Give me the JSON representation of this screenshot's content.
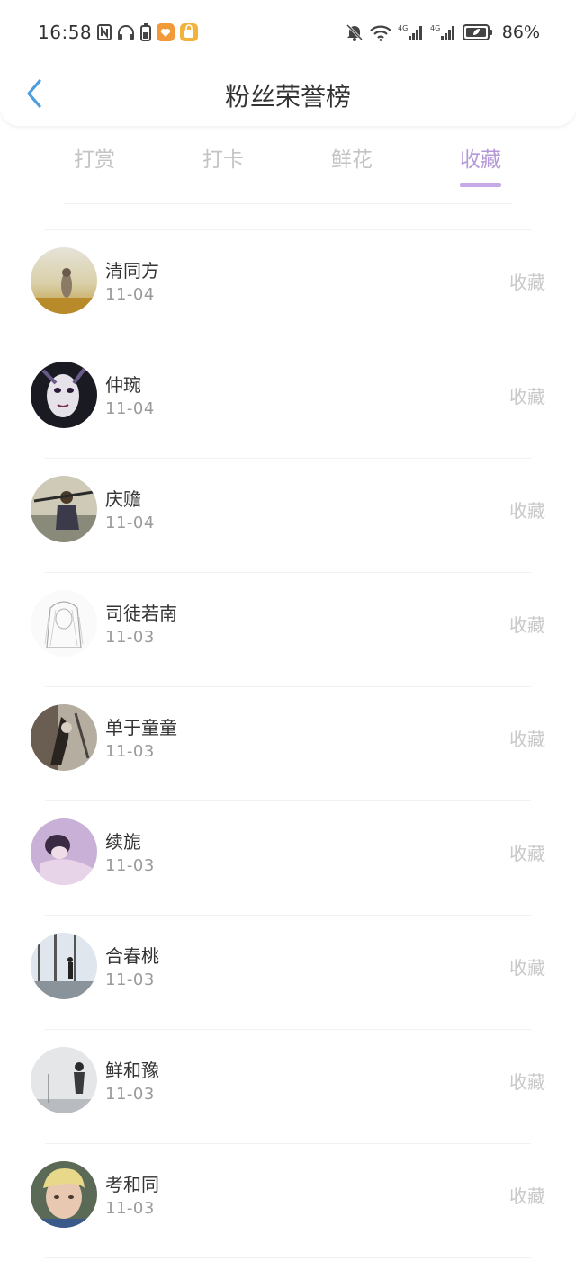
{
  "status_bar": {
    "time": "16:58",
    "battery": "86%",
    "left_icons": [
      "nfc-icon",
      "headphones-icon",
      "battery-small-icon",
      "app-heart-icon",
      "app-bag-icon"
    ],
    "right_icons": [
      "bell-muted-icon",
      "wifi-icon",
      "signal-4g-icon",
      "signal-4g-icon-2",
      "battery-icon"
    ]
  },
  "header": {
    "title": "粉丝荣誉榜"
  },
  "tabs": [
    {
      "label": "打赏",
      "active": false
    },
    {
      "label": "打卡",
      "active": false
    },
    {
      "label": "鲜花",
      "active": false
    },
    {
      "label": "收藏",
      "active": true
    }
  ],
  "colors": {
    "accent": "#b598d8",
    "underline": "#c6a9e6",
    "back_arrow": "#4a9de0"
  },
  "fans": [
    {
      "name": "清同方",
      "date": "11-04",
      "action": "收藏"
    },
    {
      "name": "仲琬",
      "date": "11-04",
      "action": "收藏"
    },
    {
      "name": "庆赡",
      "date": "11-04",
      "action": "收藏"
    },
    {
      "name": "司徒若南",
      "date": "11-03",
      "action": "收藏"
    },
    {
      "name": "单于童童",
      "date": "11-03",
      "action": "收藏"
    },
    {
      "name": "续旎",
      "date": "11-03",
      "action": "收藏"
    },
    {
      "name": "合春桃",
      "date": "11-03",
      "action": "收藏"
    },
    {
      "name": "鲜和豫",
      "date": "11-03",
      "action": "收藏"
    },
    {
      "name": "考和同",
      "date": "11-03",
      "action": "收藏"
    }
  ]
}
